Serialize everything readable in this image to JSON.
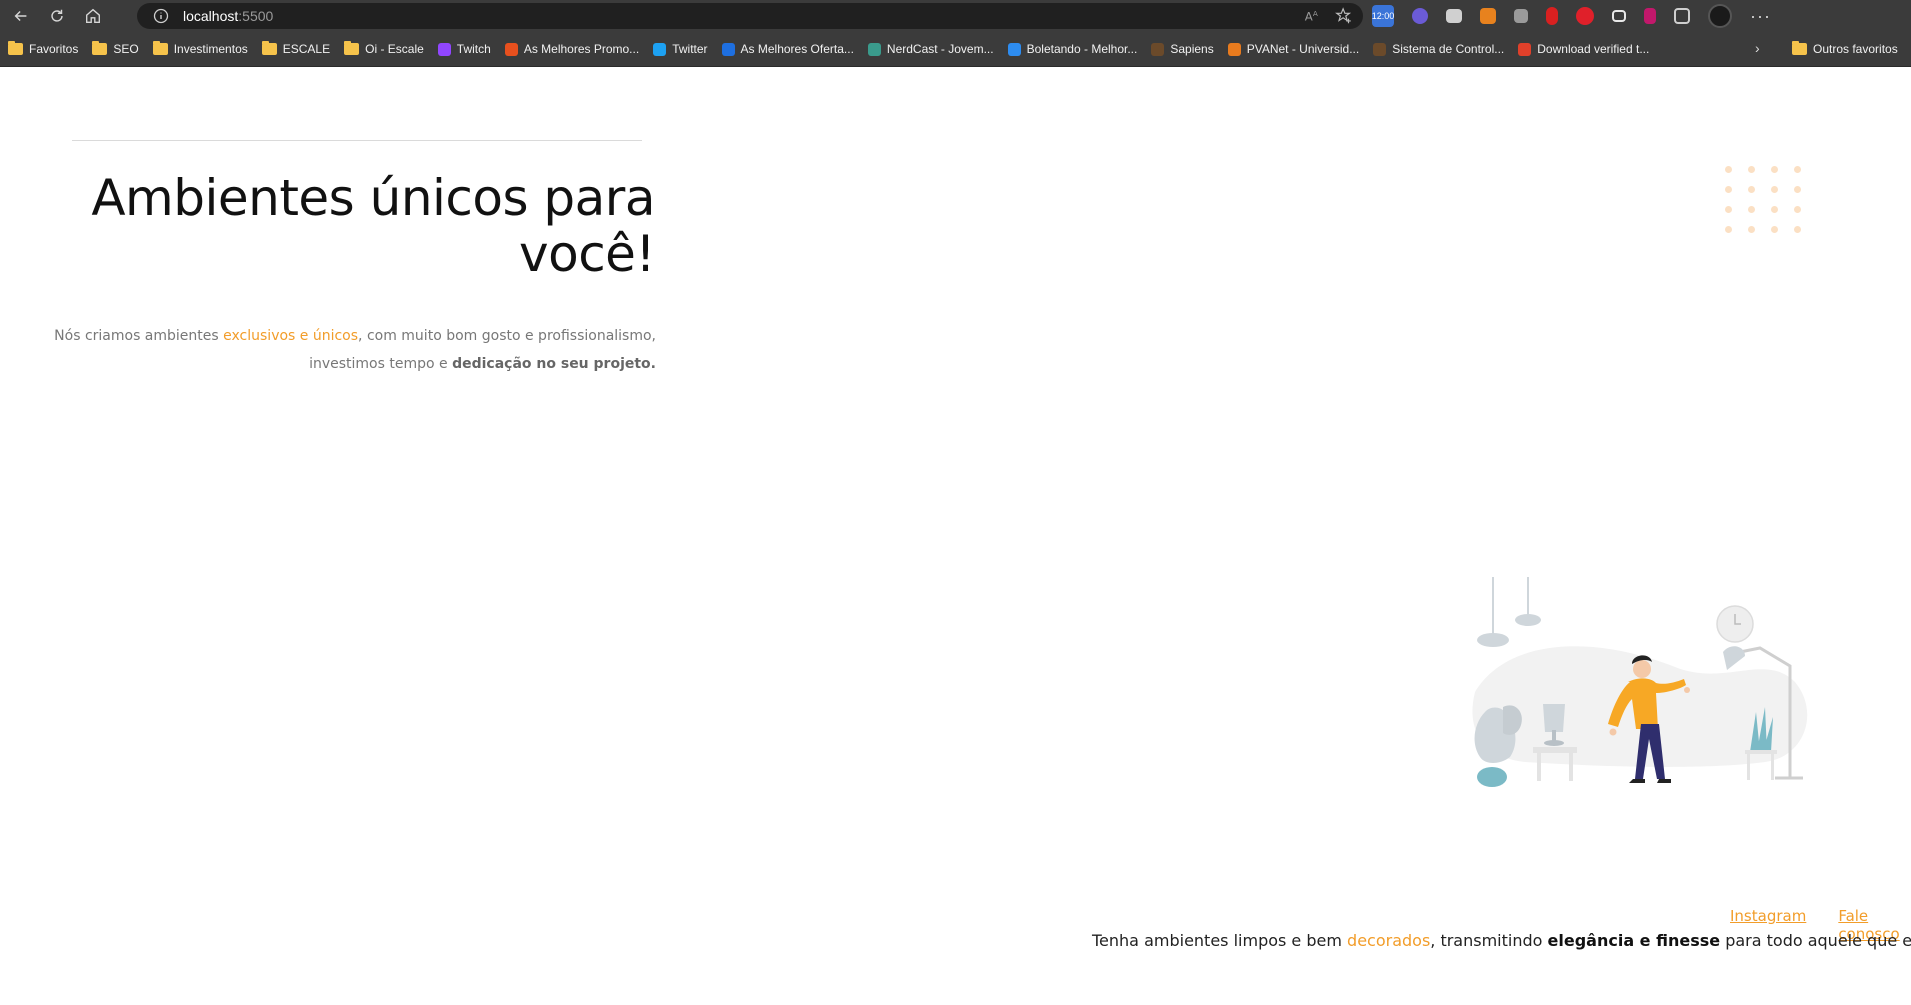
{
  "browser": {
    "url_host": "localhost",
    "url_port": ":5500",
    "extensions": [
      {
        "name": "calendar-extension",
        "label": "12:00",
        "color": "#3a74d8"
      },
      {
        "name": "ghost-extension",
        "label": "",
        "color": "#6b5bd6"
      },
      {
        "name": "print-extension",
        "label": "",
        "color": "#777777"
      },
      {
        "name": "metamask-extension",
        "label": "",
        "color": "#e8821e"
      },
      {
        "name": "copy-extension",
        "label": "",
        "color": "#8a8a8a"
      },
      {
        "name": "stop-extension",
        "label": "",
        "color": "#d92020"
      },
      {
        "name": "record-extension",
        "label": "",
        "color": "#e0202a"
      },
      {
        "name": "window-extension",
        "label": "",
        "color": "#5a5a5a"
      },
      {
        "name": "phone-extension",
        "label": "",
        "color": "#c2186b"
      },
      {
        "name": "puzzle-extension",
        "label": "",
        "color": "#5a5a5a"
      }
    ]
  },
  "bookmarks": [
    {
      "label": "Favoritos",
      "icon": "folder"
    },
    {
      "label": "SEO",
      "icon": "folder"
    },
    {
      "label": "Investimentos",
      "icon": "folder"
    },
    {
      "label": "ESCALE",
      "icon": "folder"
    },
    {
      "label": "Oi - Escale",
      "icon": "folder"
    },
    {
      "label": "Twitch",
      "icon": "twitch"
    },
    {
      "label": "As Melhores Promo...",
      "icon": "flame"
    },
    {
      "label": "Twitter",
      "icon": "twitter"
    },
    {
      "label": "As Melhores Oferta...",
      "icon": "dollar"
    },
    {
      "label": "NerdCast - Jovem...",
      "icon": "nerd"
    },
    {
      "label": "Boletando - Melhor...",
      "icon": "b"
    },
    {
      "label": "Sapiens",
      "icon": "uv"
    },
    {
      "label": "PVANet - Universid...",
      "icon": "pva"
    },
    {
      "label": "Sistema de Control...",
      "icon": "uv"
    },
    {
      "label": "Download verified t...",
      "icon": "x"
    }
  ],
  "other_bookmarks": "Outros favoritos",
  "hero": {
    "title": "Ambientes únicos para você!",
    "text_before": "Nós criamos ambientes ",
    "text_accent": "exclusivos e únicos",
    "text_middle": ", com muito bom gosto e profissionalismo, investimos tempo e ",
    "text_bold": "dedicação no seu projeto."
  },
  "links": {
    "instagram": "Instagram",
    "contact": "Fale conosco"
  },
  "footer": {
    "before": "Tenha ambientes limpos e bem ",
    "accent": "decorados",
    "middle": ", transmitindo ",
    "bold": "elegância e finesse",
    "after": " para todo aquele que estiver ali."
  },
  "colors": {
    "accent": "#f29d2a",
    "chrome": "#3b3b3b"
  }
}
